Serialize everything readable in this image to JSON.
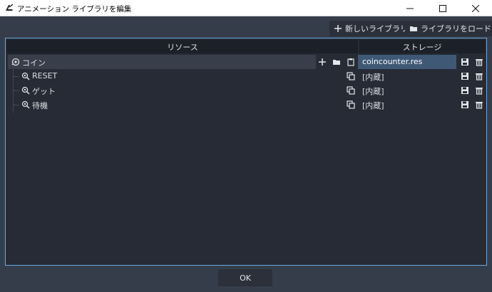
{
  "window": {
    "title": "アニメーション ライブラリを編集"
  },
  "toolbar": {
    "new_library": "新しいライブラリ",
    "load_library": "ライブラリをロード"
  },
  "columns": {
    "resource": "リソース",
    "storage": "ストレージ"
  },
  "library": {
    "name": "コイン",
    "storage": "coincounter.res"
  },
  "animations": [
    {
      "name": "RESET",
      "storage": "[内蔵]"
    },
    {
      "name": "ゲット",
      "storage": "[内蔵]"
    },
    {
      "name": "待機",
      "storage": "[内蔵]"
    }
  ],
  "footer": {
    "ok_label": "OK"
  },
  "colors": {
    "accent_border": "#6aa9e0",
    "storage_highlight": "#3f5876",
    "background": "#363d4a"
  }
}
